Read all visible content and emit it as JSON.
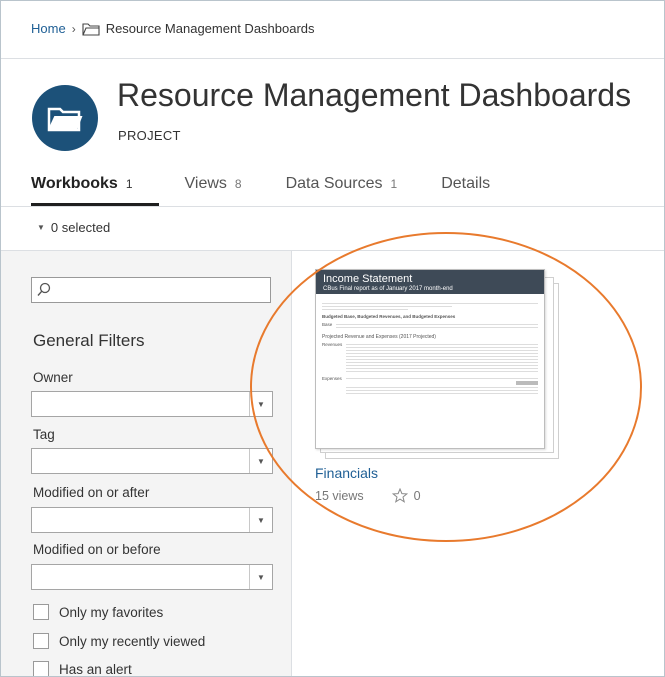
{
  "breadcrumb": {
    "home": "Home",
    "separator": "›",
    "current": "Resource Management Dashboards"
  },
  "project": {
    "title": "Resource Management Dashboards",
    "type_label": "PROJECT",
    "icon": "folder-icon"
  },
  "tabs": [
    {
      "label": "Workbooks",
      "count": "1",
      "active": true
    },
    {
      "label": "Views",
      "count": "8"
    },
    {
      "label": "Data Sources",
      "count": "1"
    },
    {
      "label": "Details",
      "count": ""
    }
  ],
  "selection": {
    "label": "0 selected"
  },
  "sidebar": {
    "search_placeholder": "",
    "filters_title": "General Filters",
    "owner_label": "Owner",
    "tag_label": "Tag",
    "modified_after_label": "Modified on or after",
    "modified_before_label": "Modified on or before",
    "checkboxes": [
      "Only my favorites",
      "Only my recently viewed",
      "Has an alert"
    ]
  },
  "workbook": {
    "name": "Financials",
    "views": "15 views",
    "favorites": "0",
    "thumbnail": {
      "title": "Income Statement",
      "subtitle": "CBus Final report as of January 2017 month-end",
      "section1": "Budgeted Base, Budgeted Revenues, and Budgeted Expenses",
      "section2": "Projected Revenue and Expenses (2017 Projected)",
      "rows": [
        "Base",
        "Revenues",
        "Expenses"
      ]
    }
  },
  "colors": {
    "accent": "#1f5f95",
    "project_icon_bg": "#1c5179",
    "annotation": "#e87a2d",
    "thumb_header": "#3e4a57"
  }
}
